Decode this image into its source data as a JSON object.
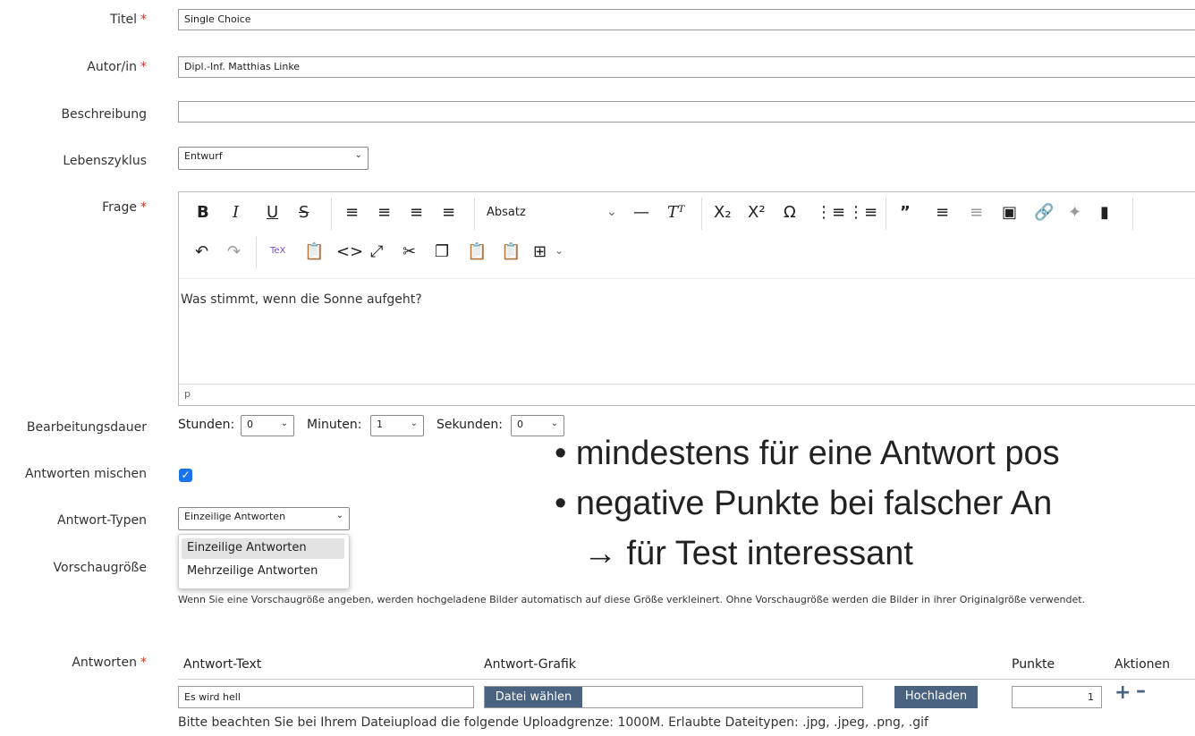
{
  "form": {
    "title_label": "Titel",
    "title_value": "Single Choice",
    "author_label": "Autor/in",
    "author_value": "Dipl.-Inf. Matthias Linke",
    "description_label": "Beschreibung",
    "description_value": "",
    "lifecycle_label": "Lebenszyklus",
    "lifecycle_value": "Entwurf",
    "question_label": "Frage",
    "required_mark": "*"
  },
  "editor": {
    "format_label": "Absatz",
    "content": "Was stimmt, wenn die Sonne aufgeht?",
    "status_path": "p"
  },
  "duration": {
    "label": "Bearbeitungsdauer",
    "hours_label": "Stunden:",
    "hours_value": "0",
    "minutes_label": "Minuten:",
    "minutes_value": "1",
    "seconds_label": "Sekunden:",
    "seconds_value": "0"
  },
  "shuffle": {
    "label": "Antworten mischen",
    "checked": true
  },
  "answer_types": {
    "label": "Antwort-Typen",
    "value": "Einzeilige Antworten",
    "options": [
      "Einzeilige Antworten",
      "Mehrzeilige Antworten"
    ]
  },
  "preview": {
    "label": "Vorschaugröße",
    "help": "Wenn Sie eine Vorschaugröße angeben, werden hochgeladene Bilder automatisch auf diese Größe verkleinert. Ohne Vorschaugröße werden die Bilder in ihrer Originalgröße verwendet."
  },
  "answers": {
    "label": "Antworten",
    "col_text": "Antwort-Text",
    "col_graphic": "Antwort-Grafik",
    "col_points": "Punkte",
    "col_actions": "Aktionen",
    "row1_text": "Es wird hell",
    "choose_file": "Datei wählen",
    "upload": "Hochladen",
    "row1_points": "1",
    "upload_note": "Bitte beachten Sie bei Ihrem Dateiupload die folgende Uploadgrenze: 1000M. Erlaubte Dateitypen: .jpg, .jpeg, .png, .gif"
  },
  "overlay": {
    "bullet1": "• mindestens für eine Antwort pos",
    "bullet2": "• negative Punkte bei falscher An",
    "line3": "→ für Test interessant"
  }
}
